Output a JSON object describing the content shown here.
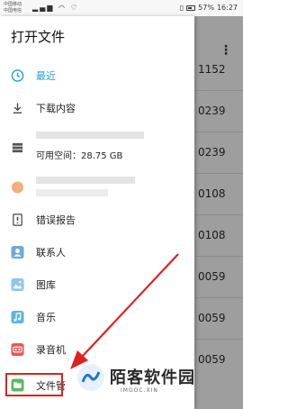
{
  "status_bar": {
    "carrier1": "中国移动",
    "carrier2": "中国电信",
    "battery": "57%",
    "time": "16:27"
  },
  "drawer": {
    "title": "打开文件",
    "items": [
      {
        "label": "最近",
        "icon": "clock-icon",
        "active": true
      },
      {
        "label": "下载内容",
        "icon": "download-icon"
      },
      {
        "label": "",
        "icon": "storage-icon"
      },
      {
        "label": "",
        "icon": "sd-card-icon"
      },
      {
        "label": "错误报告",
        "icon": "bug-report-icon"
      },
      {
        "label": "联系人",
        "icon": "contacts-app-icon"
      },
      {
        "label": "图库",
        "icon": "gallery-app-icon"
      },
      {
        "label": "音乐",
        "icon": "music-app-icon"
      },
      {
        "label": "录音机",
        "icon": "recorder-app-icon"
      },
      {
        "label": "文件管",
        "icon": "files-app-icon"
      }
    ],
    "storage_free": "可用空间：28.75 GB"
  },
  "underlying_list": [
    "1152",
    "0239",
    "0239",
    "0108",
    "0108",
    "0059",
    "0059",
    "0059",
    "0059"
  ],
  "watermark": {
    "title": "陌客软件园",
    "url": "IMOOC.XIN"
  },
  "colors": {
    "accent": "#1c9fd8",
    "highlight_red": "#e02020"
  }
}
